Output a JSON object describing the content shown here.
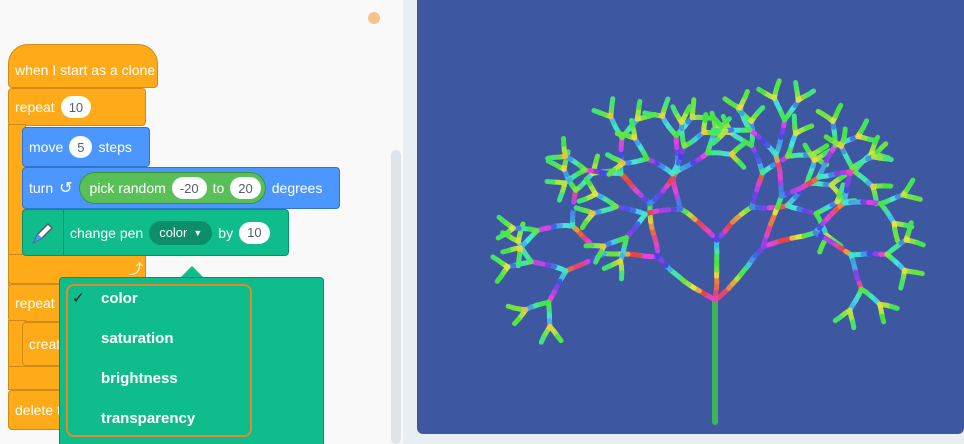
{
  "blocks": {
    "hat": {
      "label": "when I start as a clone"
    },
    "repeat1": {
      "label": "repeat",
      "value": "10"
    },
    "move": {
      "label": "move",
      "value": "5",
      "unit": "steps"
    },
    "turn": {
      "label": "turn",
      "reporter": "pick random",
      "from": "-20",
      "to_label": "to",
      "to": "20",
      "unit": "degrees"
    },
    "pen": {
      "label": "change pen",
      "param": "color",
      "by_label": "by",
      "value": "10"
    },
    "repeat2": {
      "label": "repeat"
    },
    "create": {
      "label": "creat"
    },
    "delete": {
      "label": "delete t"
    }
  },
  "dropdown": {
    "selected": "color",
    "options": [
      "color",
      "saturation",
      "brightness",
      "transparency"
    ]
  },
  "colors": {
    "control": "#ffab19",
    "motion": "#4c97ff",
    "pen": "#0fbd8c",
    "operators": "#59c059",
    "stage": "#3d58a1",
    "highlight": "#e08b2e"
  }
}
